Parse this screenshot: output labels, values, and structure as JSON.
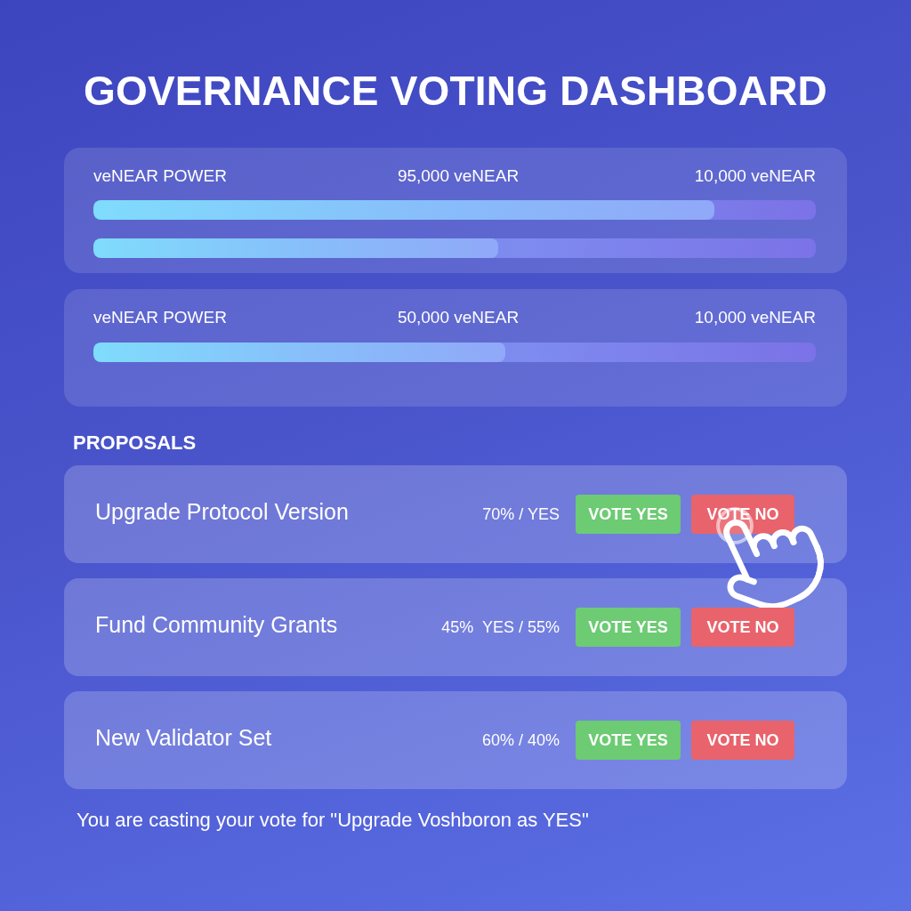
{
  "title": "GOVERNANCE VOTING DASHBOARD",
  "power_cards": [
    {
      "label": "veNEAR POWER",
      "amount": "95,000 veNEAR",
      "amount_2": "10,000 veNEAR",
      "bars": [
        {
          "level": 0.86
        },
        {
          "level": 0.56
        }
      ]
    },
    {
      "label": "veNEAR POWER",
      "amount": "50,000 veNEAR",
      "amount_2": "10,000 veNEAR",
      "bars": [
        {
          "level": 0.57
        }
      ]
    }
  ],
  "proposals": {
    "heading": "PROPOSALS",
    "items": [
      {
        "title": "Upgrade Protocol Version",
        "result": "70% / YES",
        "yes_button": "VOTE YES",
        "no_button": "VOTE NO",
        "cursor": true
      },
      {
        "title": "Fund Community Grants",
        "result": "45%  YES / 55%",
        "yes_button": "VOTE YES",
        "no_button": "VOTE NO",
        "cursor": false
      },
      {
        "title": "New Validator Set",
        "result": "60% / 40%",
        "yes_button": "VOTE YES",
        "no_button": "VOTE NO",
        "cursor": false
      }
    ]
  },
  "footer": "You are casting your vote for \"Upgrade Voshboron as YES\""
}
